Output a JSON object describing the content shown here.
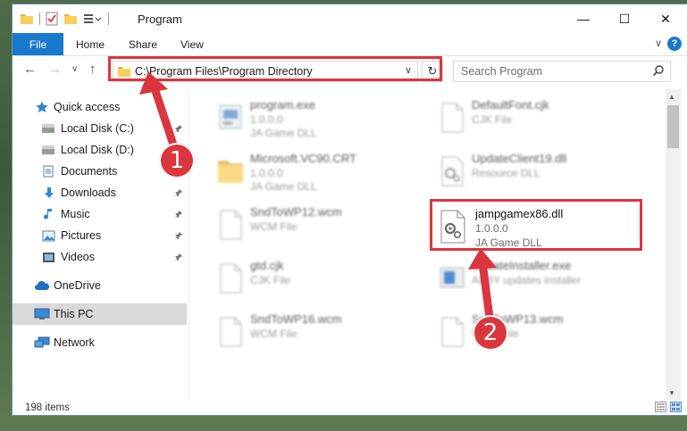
{
  "window": {
    "title": "Program",
    "controls": {
      "minimize": "—",
      "maximize": "☐",
      "close": "✕"
    }
  },
  "ribbon": {
    "tabs": [
      "File",
      "Home",
      "Share",
      "View"
    ],
    "help": "?",
    "expand": "∨"
  },
  "nav": {
    "back": "←",
    "forward": "→",
    "recent": "∨",
    "up": "↑",
    "address_path": "C:\\Program Files\\Program Directory",
    "address_dropdown": "∨",
    "refresh": "↻",
    "search_placeholder": "Search Program"
  },
  "sidebar": {
    "items": [
      {
        "label": "Quick access",
        "icon": "star-icon",
        "pinned": false
      },
      {
        "label": "Local Disk (C:)",
        "icon": "drive-icon",
        "pinned": true
      },
      {
        "label": "Local Disk (D:)",
        "icon": "drive-icon",
        "pinned": false
      },
      {
        "label": "Documents",
        "icon": "documents-icon",
        "pinned": true
      },
      {
        "label": "Downloads",
        "icon": "downloads-icon",
        "pinned": true
      },
      {
        "label": "Music",
        "icon": "music-icon",
        "pinned": true
      },
      {
        "label": "Pictures",
        "icon": "pictures-icon",
        "pinned": true
      },
      {
        "label": "Videos",
        "icon": "videos-icon",
        "pinned": true
      },
      {
        "label": "OneDrive",
        "icon": "onedrive-icon",
        "pinned": false
      },
      {
        "label": "This PC",
        "icon": "this-pc-icon",
        "pinned": false,
        "selected": true
      },
      {
        "label": "Network",
        "icon": "network-icon",
        "pinned": false
      }
    ]
  },
  "files": {
    "left_column": [
      {
        "name": "program.exe",
        "line2": "1.0.0.0",
        "line3": "JA Game DLL",
        "icon": "exe-icon"
      },
      {
        "name": "Microsoft.VC90.CRT",
        "line2": "1.0.0.0",
        "line3": "JA Game DLL",
        "icon": "folder-icon"
      },
      {
        "name": "SndToWP12.wcm",
        "line2": "WCM File",
        "line3": "",
        "icon": "file-icon"
      },
      {
        "name": "gtd.cjk",
        "line2": "CJK File",
        "line3": "",
        "icon": "file-icon"
      },
      {
        "name": "SndToWP16.wcm",
        "line2": "WCM File",
        "line3": "",
        "icon": "file-icon"
      }
    ],
    "right_column": [
      {
        "name": "DefaultFont.cjk",
        "line2": "CJK File",
        "line3": "",
        "icon": "file-icon"
      },
      {
        "name": "UpdateClient19.dll",
        "line2": "Resource DLL",
        "line3": "",
        "icon": "dll-icon"
      },
      {
        "name": "UpdateInstaller.exe",
        "line2": "ABBY updates installer",
        "line3": "",
        "icon": "installer-icon"
      },
      {
        "name": "SndToWP13.wcm",
        "line2": "WCM File",
        "line3": "",
        "icon": "file-icon"
      }
    ],
    "highlighted": {
      "name": "jampgamex86.dll",
      "line2": "1.0.0.0",
      "line3": "JA Game DLL",
      "icon": "dll-gear-icon"
    }
  },
  "status": {
    "item_count": "198 items"
  },
  "annotations": {
    "step1": "1",
    "step2": "2",
    "color": "#d9363e"
  },
  "colors": {
    "accent": "#1979ca",
    "selection": "#d9d9d9"
  }
}
